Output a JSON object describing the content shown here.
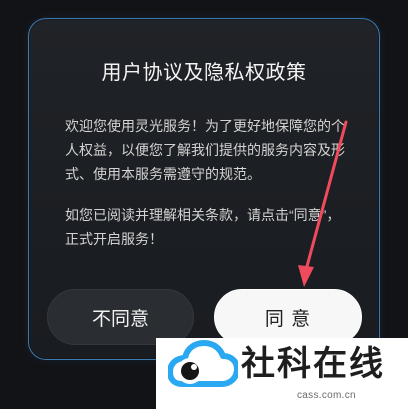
{
  "dialog": {
    "title": "用户协议及隐私权政策",
    "paragraphs": [
      "欢迎您使用灵光服务！为了更好地保障您的个人权益，以便您了解我们提供的服务内容及形式、使用本服务需遵守的规范。",
      "如您已阅读并理解相关条款，请点击“同意”，正式开启服务！"
    ],
    "buttons": {
      "disagree": "不同意",
      "agree": "同 意"
    }
  },
  "overlay": {
    "arrow_color": "#f04b5c"
  },
  "watermark": {
    "brand": "社科在线",
    "domain": "cass.com.cn",
    "accent_color": "#2aa8f2",
    "logo_icon": "cloud-eye-logo"
  }
}
